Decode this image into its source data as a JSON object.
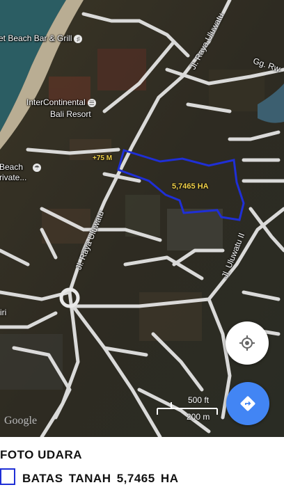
{
  "map": {
    "labels": {
      "beach_bar": "et Beach Bar & Grill",
      "intercontinental_1": "InterContinental",
      "intercontinental_2": "Bali Resort",
      "beach_left_1": "Beach",
      "beach_left_2": "rivate...",
      "road_gg_rw": "Gg. Rw.",
      "road_raya_uluwatu_top": "Jl. Raya Uluwatu",
      "road_raya_uluwatu_mid": "Jl. Raya Uluwatu",
      "road_uluwatu_ii": "Jl. Uluwatu II",
      "road_left_edge": "iri",
      "elevation": "+75 M",
      "parcel_area": "5,7465 HA"
    },
    "icons": {
      "restaurant": "fork-knife-icon",
      "hotel": "bed-icon",
      "beach_club": "umbrella-icon"
    },
    "scale": {
      "feet": "500 ft",
      "meters": "200 m"
    },
    "attribution": "Google",
    "colors": {
      "parcel_outline": "#1f2fd6",
      "directions_button": "#4285f4",
      "label_highlight": "#f3d34a"
    }
  },
  "caption": {
    "title": "FOTO  UDARA",
    "legend_label": "BATAS  TANAH  5,7465 HA"
  }
}
